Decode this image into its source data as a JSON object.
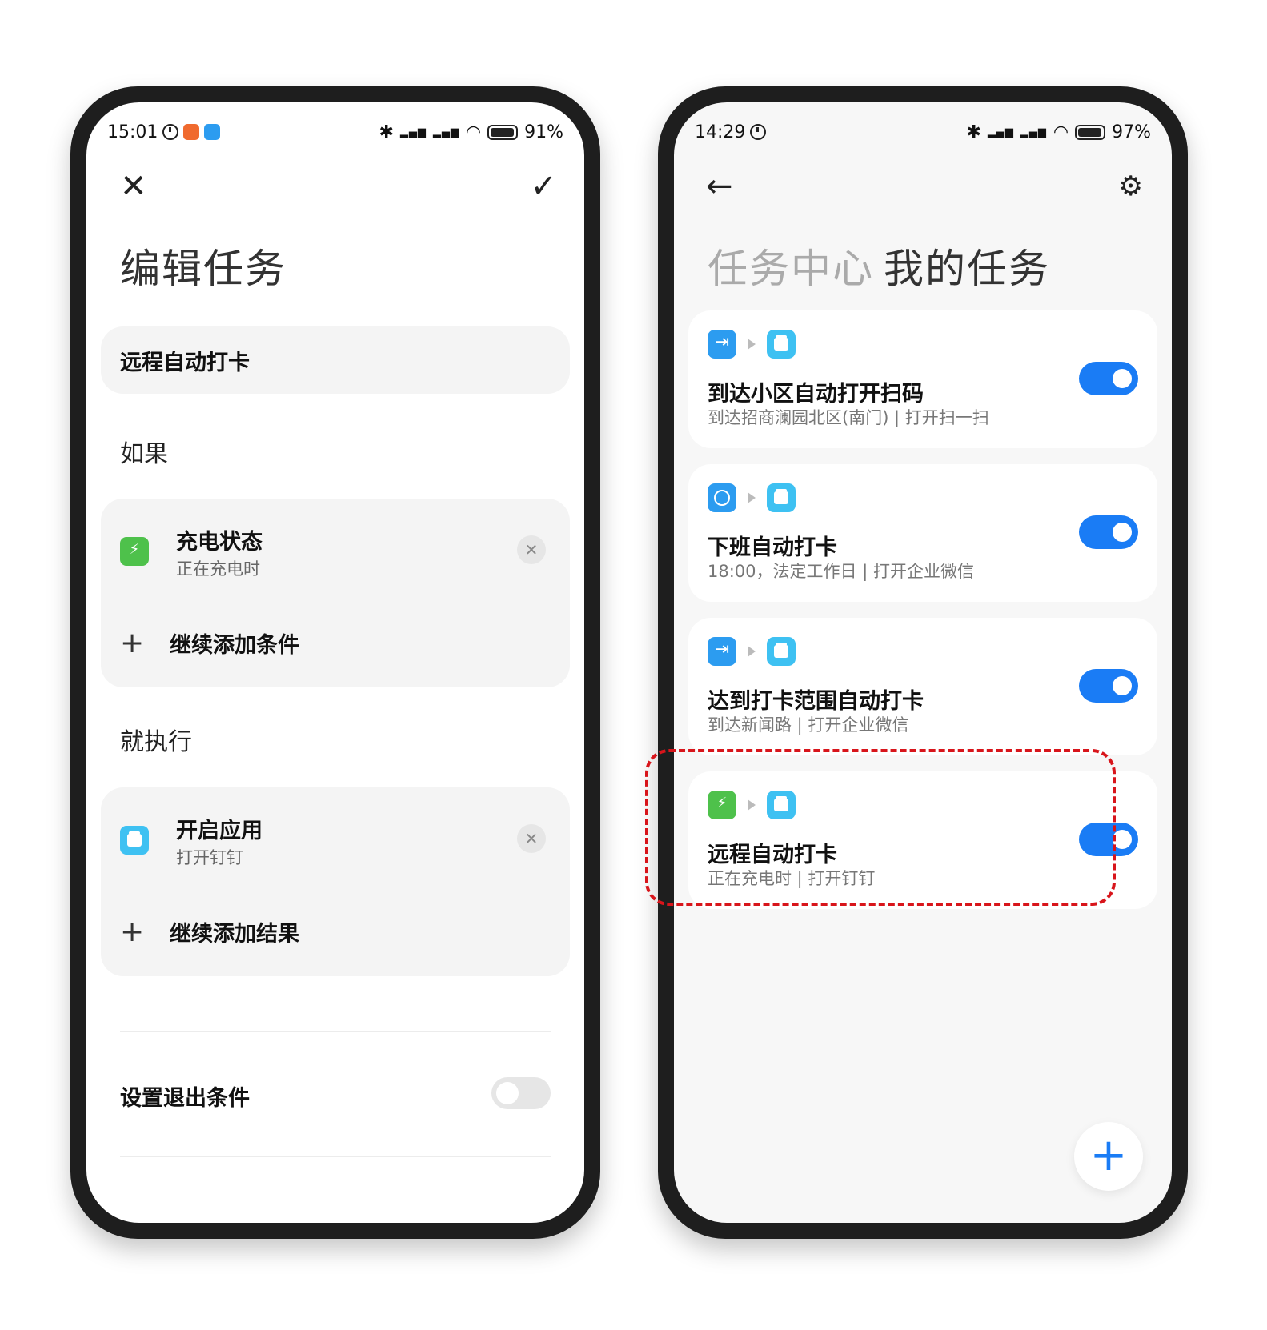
{
  "left_phone": {
    "status": {
      "time": "15:01",
      "battery": "91%"
    },
    "title": "编辑任务",
    "task_name": "远程自动打卡",
    "if_label": "如果",
    "condition": {
      "title": "充电状态",
      "subtitle": "正在充电时"
    },
    "add_condition": "继续添加条件",
    "then_label": "就执行",
    "action": {
      "title": "开启应用",
      "subtitle": "打开钉钉"
    },
    "add_result": "继续添加结果",
    "exit_condition": {
      "label": "设置退出条件",
      "enabled": false
    }
  },
  "right_phone": {
    "status": {
      "time": "14:29",
      "battery": "97%"
    },
    "tab_inactive": "任务中心",
    "tab_active": "我的任务",
    "tasks": [
      {
        "title": "到达小区自动打开扫码",
        "subtitle": "到达招商澜园北区(南门) | 打开扫一扫",
        "trigger_icon": "arrive-icon",
        "enabled": true
      },
      {
        "title": "下班自动打卡",
        "subtitle": "18:00，法定工作日 | 打开企业微信",
        "trigger_icon": "clock-icon",
        "enabled": true
      },
      {
        "title": "达到打卡范围自动打卡",
        "subtitle": "到达新闻路 | 打开企业微信",
        "trigger_icon": "arrive-icon",
        "enabled": true
      },
      {
        "title": "远程自动打卡",
        "subtitle": "正在充电时 | 打开钉钉",
        "trigger_icon": "battery-icon",
        "enabled": true
      }
    ]
  },
  "colors": {
    "accent": "#1a7cf5",
    "highlight": "#d8151b"
  }
}
